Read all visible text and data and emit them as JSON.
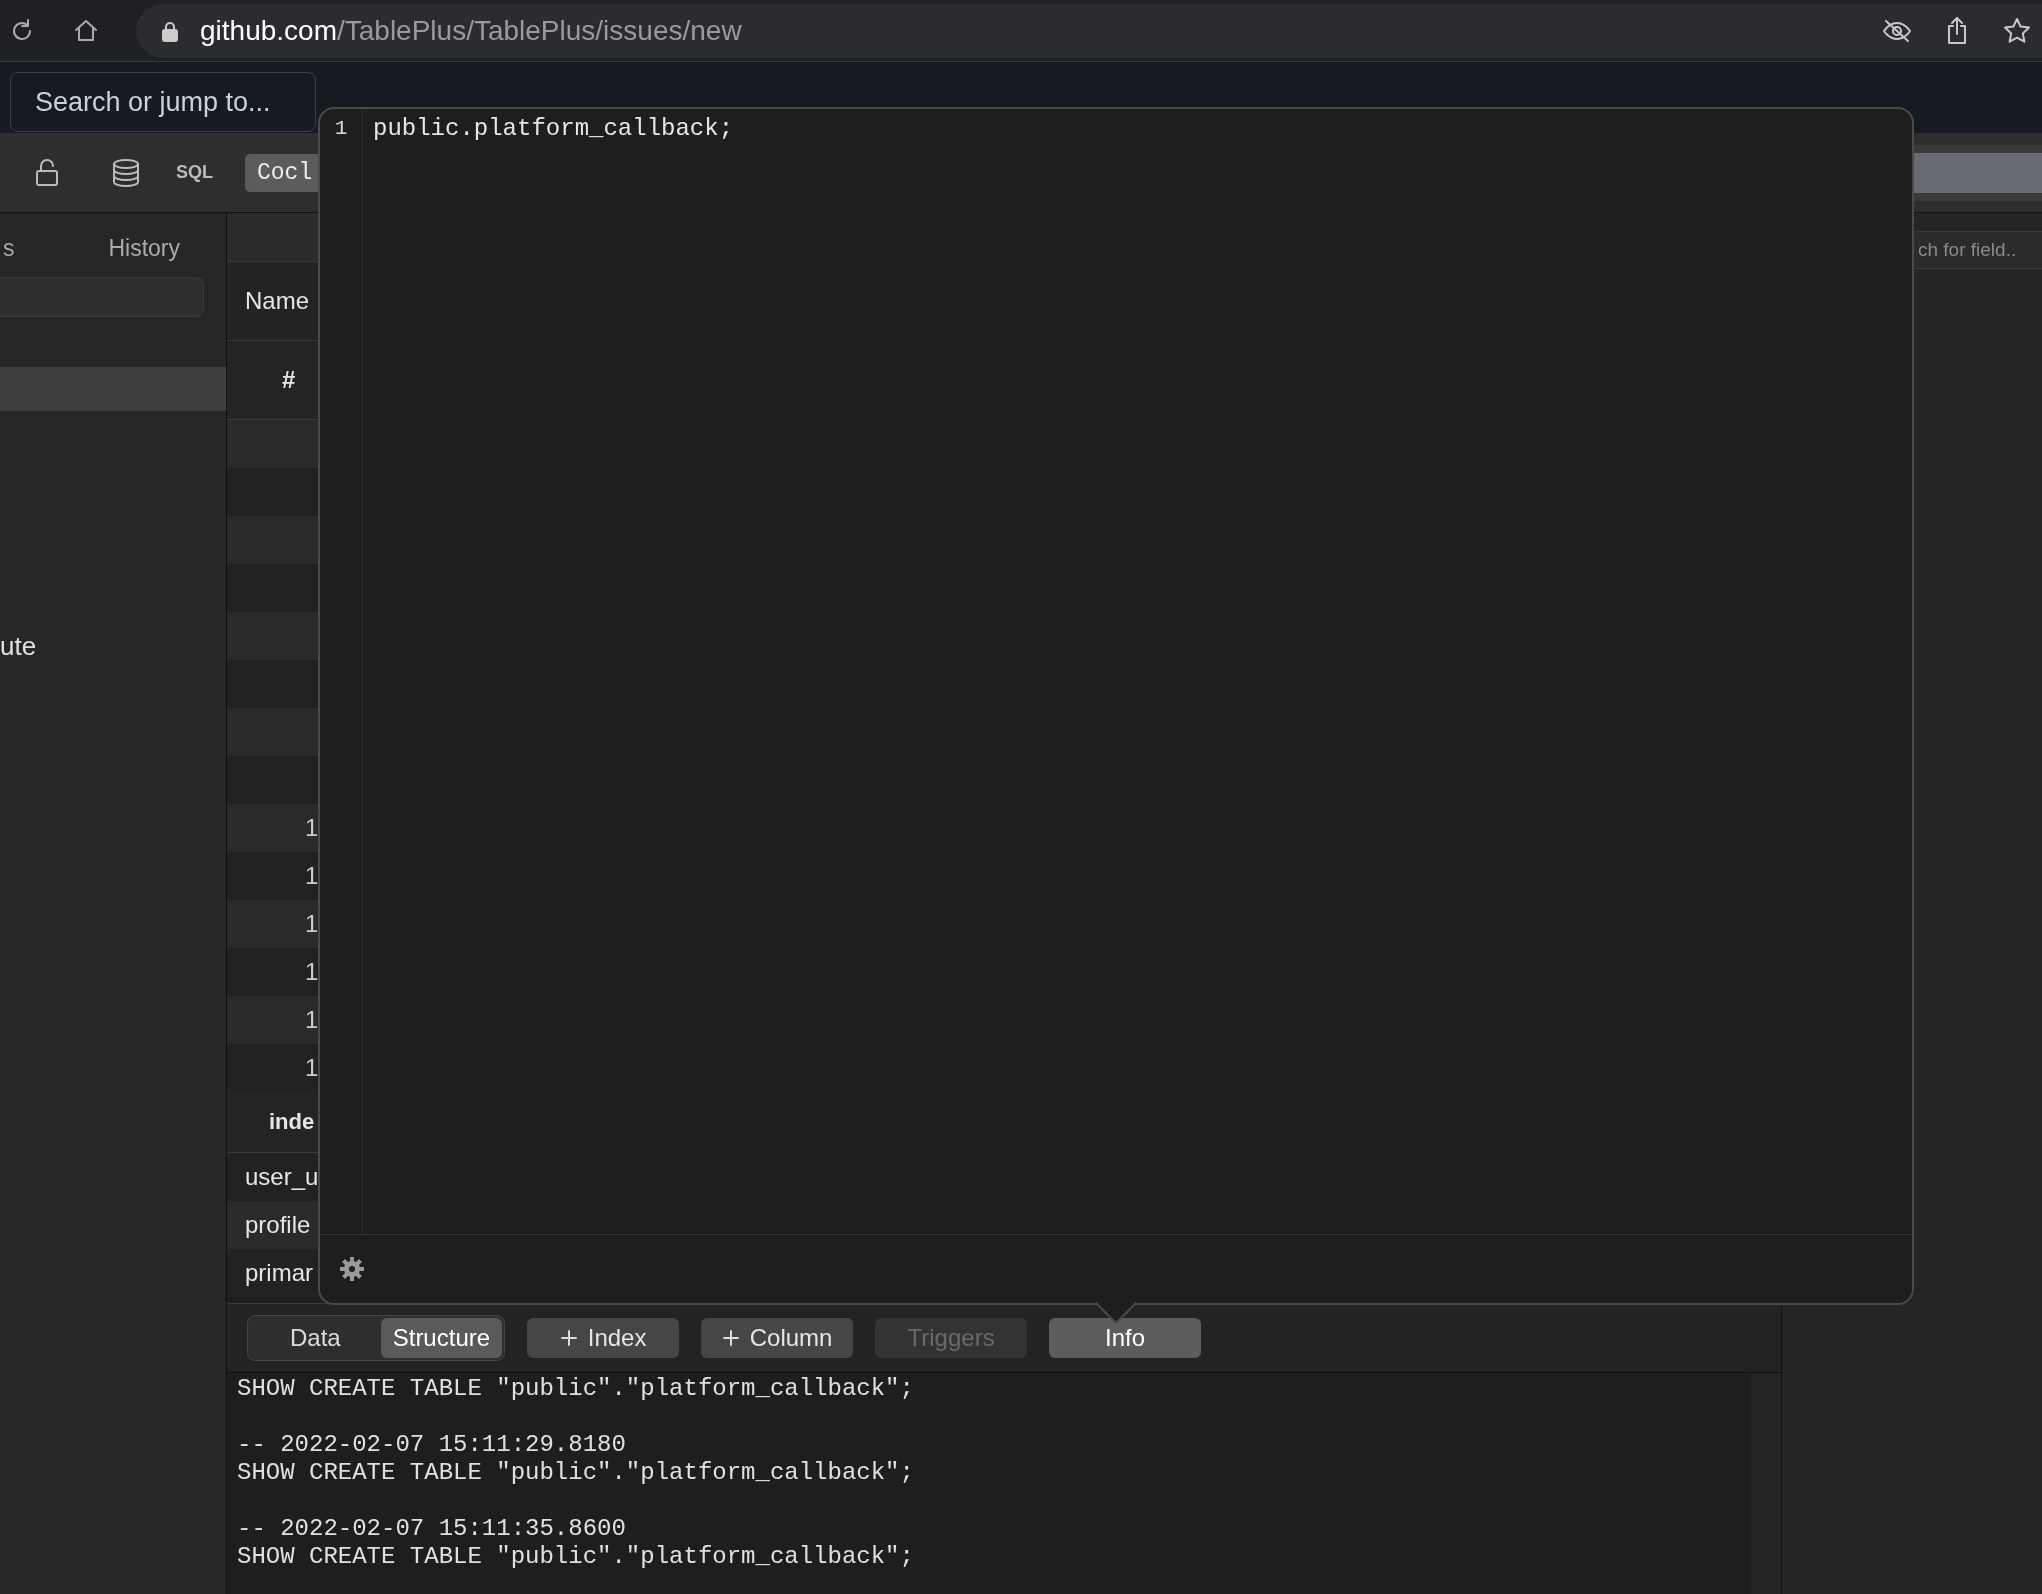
{
  "browser": {
    "url": {
      "domain": "github.com",
      "path": "/TablePlus/TablePlus/issues/new"
    }
  },
  "github": {
    "search": {
      "placeholder": "Search or jump to..."
    }
  },
  "toolbar": {
    "sql_label": "SQL",
    "tabs": [
      {
        "label": "Cocl",
        "selected": true
      }
    ]
  },
  "sidebar": {
    "tabs": [
      {
        "label": "s",
        "selected": false
      },
      {
        "label": "History",
        "selected": false
      }
    ],
    "items": [
      {
        "label": "ute",
        "selected": false
      }
    ]
  },
  "structure": {
    "header": "Name",
    "columns": [
      "#"
    ],
    "rows": [
      {
        "cells": [
          ""
        ]
      },
      {
        "cells": [
          ""
        ]
      },
      {
        "cells": [
          ""
        ]
      },
      {
        "cells": [
          ""
        ]
      },
      {
        "cells": [
          ""
        ]
      },
      {
        "cells": [
          ""
        ]
      },
      {
        "cells": [
          ""
        ]
      },
      {
        "cells": [
          ""
        ]
      },
      {
        "cells": [
          "1"
        ]
      },
      {
        "cells": [
          "1"
        ]
      },
      {
        "cells": [
          "1"
        ]
      },
      {
        "cells": [
          "1"
        ]
      },
      {
        "cells": [
          "1"
        ]
      },
      {
        "cells": [
          "1"
        ]
      }
    ]
  },
  "indexes": {
    "header": "inde",
    "rows": [
      "user_u",
      "profile",
      "primar"
    ]
  },
  "bottom_bar": {
    "segments": [
      {
        "label": "Data",
        "selected": false
      },
      {
        "label": "Structure",
        "selected": true
      }
    ],
    "buttons": [
      {
        "label": "Index",
        "kind": "add",
        "disabled": false,
        "selected": false
      },
      {
        "label": "Column",
        "kind": "add",
        "disabled": false,
        "selected": false
      },
      {
        "label": "Triggers",
        "kind": "plain",
        "disabled": true,
        "selected": false
      },
      {
        "label": "Info",
        "kind": "plain",
        "disabled": false,
        "selected": true
      }
    ]
  },
  "console": {
    "lines": [
      "SHOW CREATE TABLE \"public\".\"platform_callback\";",
      "-- 2022-02-07 15:11:29.8180",
      "SHOW CREATE TABLE \"public\".\"platform_callback\";",
      "-- 2022-02-07 15:11:35.8600",
      "SHOW CREATE TABLE \"public\".\"platform_callback\";"
    ]
  },
  "right_panel": {
    "search": {
      "placeholder": "ch for field.."
    }
  },
  "popover": {
    "lines": [
      {
        "number": "1",
        "text": "public.platform_callback;"
      }
    ]
  }
}
